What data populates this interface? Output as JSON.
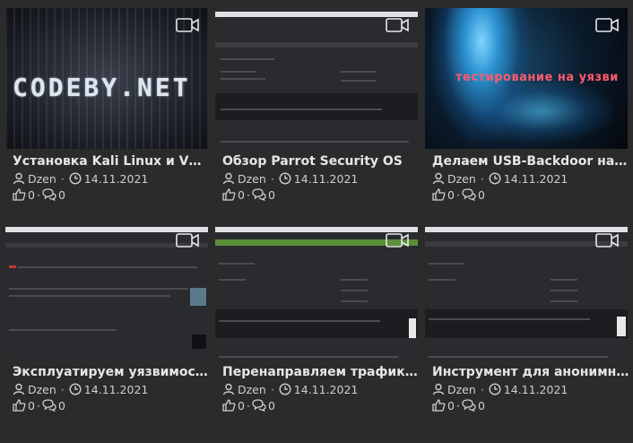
{
  "videos": [
    {
      "title": "Установка Kali Linux и VNC на ...",
      "author": "Dzen",
      "date": "14.11.2021",
      "likes": "0",
      "comments": "0",
      "thumb_text": "CODEBY.NET",
      "icon": "video-camera-icon"
    },
    {
      "title": "Обзор Parrot Security OS",
      "author": "Dzen",
      "date": "14.11.2021",
      "likes": "0",
      "comments": "0",
      "icon": "video-camera-icon"
    },
    {
      "title": "Делаем USB-Backdoor на Raspb...",
      "author": "Dzen",
      "date": "14.11.2021",
      "likes": "0",
      "comments": "0",
      "thumb_text": "тестирование на уязви",
      "icon": "video-camera-icon"
    },
    {
      "title": "Эксплуатируем уязвимость ОО...",
      "author": "Dzen",
      "date": "14.11.2021",
      "likes": "0",
      "comments": "0",
      "icon": "video-camera-icon"
    },
    {
      "title": "Перенаправляем трафик через...",
      "author": "Dzen",
      "date": "14.11.2021",
      "likes": "0",
      "comments": "0",
      "icon": "video-camera-icon"
    },
    {
      "title": "Инструмент для анонимности -...",
      "author": "Dzen",
      "date": "14.11.2021",
      "likes": "0",
      "comments": "0",
      "icon": "video-camera-icon"
    }
  ],
  "colors": {
    "background": "#2b2b2b",
    "text": "#e6e6e6",
    "meta": "#cfcfcf"
  }
}
